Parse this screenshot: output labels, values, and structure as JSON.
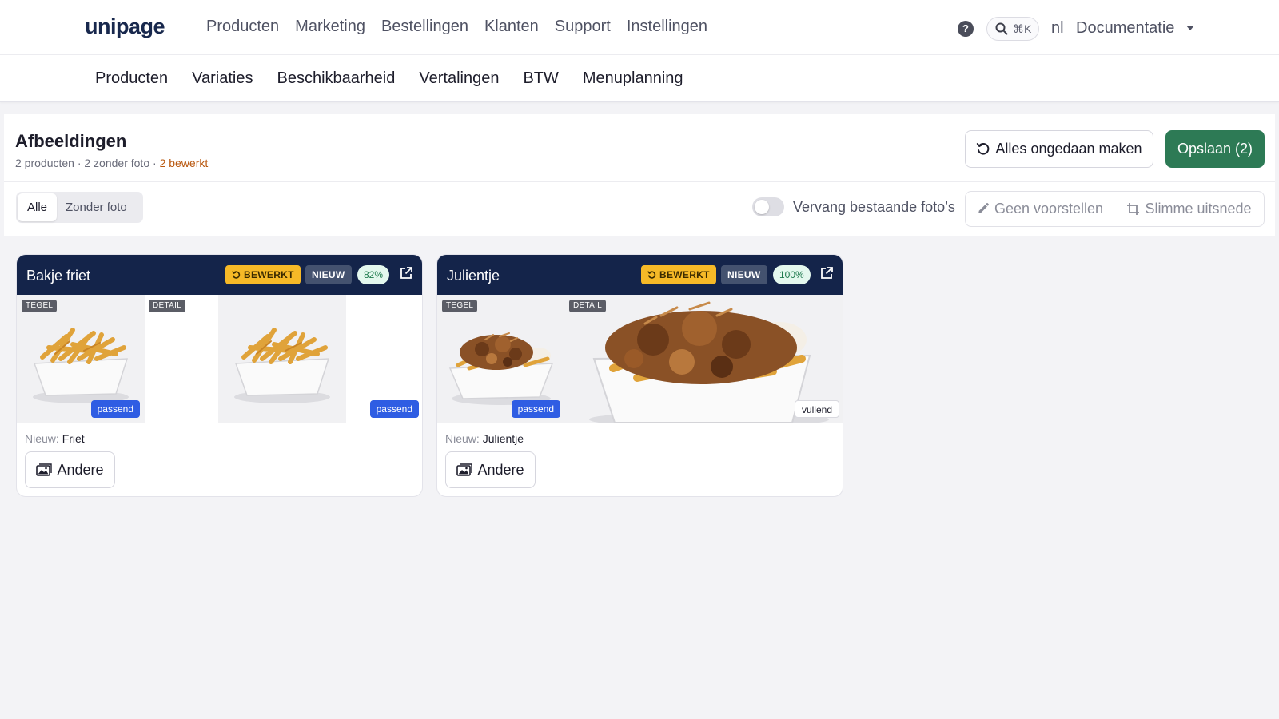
{
  "nav": {
    "logo": "unipage",
    "items": [
      "Producten",
      "Marketing",
      "Bestellingen",
      "Klanten",
      "Support",
      "Instellingen"
    ],
    "help": "?",
    "search_shortcut": "⌘K",
    "lang": "nl",
    "docs": "Documentatie"
  },
  "subnav": {
    "tabs": [
      "Producten",
      "Variaties",
      "Beschikbaarheid",
      "Vertalingen",
      "BTW",
      "Menuplanning"
    ]
  },
  "panel": {
    "title": "Afbeeldingen",
    "summary": "2 producten · 2 zonder foto · ",
    "edited_count": "2 bewerkt",
    "undo_label": "Alles ongedaan maken",
    "save_label": "Opslaan (2)",
    "filters": [
      "Alle",
      "Zonder foto"
    ],
    "replace_label": "Vervang bestaande foto’s",
    "replace_on": false,
    "suggest_label": "Geen voorstellen",
    "crop_label": "Slimme uitsnede"
  },
  "cards": [
    {
      "name": "Bakje friet",
      "edited": "BEWERKT",
      "new": "NIEUW",
      "score": "82%",
      "tile_tag": "TEGEL",
      "detail_tag": "DETAIL",
      "tile_fit": "passend",
      "detail_fit": "passend",
      "new_label": "Nieuw: ",
      "new_value": "Friet",
      "other_label": "Andere"
    },
    {
      "name": "Julientje",
      "edited": "BEWERKT",
      "new": "NIEUW",
      "score": "100%",
      "tile_tag": "TEGEL",
      "detail_tag": "DETAIL",
      "tile_fit": "passend",
      "detail_fit": "vullend",
      "new_label": "Nieuw: ",
      "new_value": "Julientje",
      "other_label": "Andere"
    }
  ],
  "colors": {
    "brand_navy": "#14244a",
    "save_green": "#2d7a55",
    "edited_amber": "#f6b927",
    "fit_blue": "#2f5de3"
  }
}
